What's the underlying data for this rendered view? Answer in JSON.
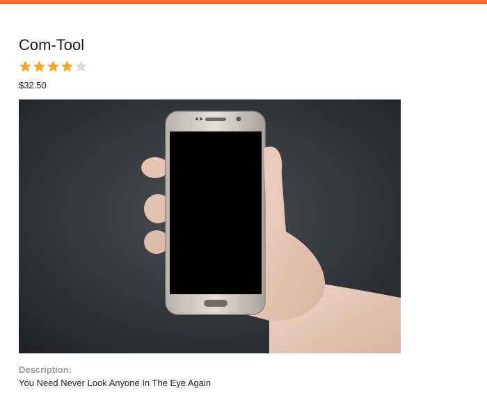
{
  "product": {
    "title": "Com-Tool",
    "rating": 4,
    "rating_max": 5,
    "price": "$32.50",
    "image_alt": "hand-holding-smartphone",
    "description_label": "Description:",
    "description": "You Need Never Look Anyone In The Eye Again"
  },
  "colors": {
    "accent_bar": "#ff6633",
    "star_filled": "#f5a623",
    "star_empty": "#dcdcdc"
  }
}
